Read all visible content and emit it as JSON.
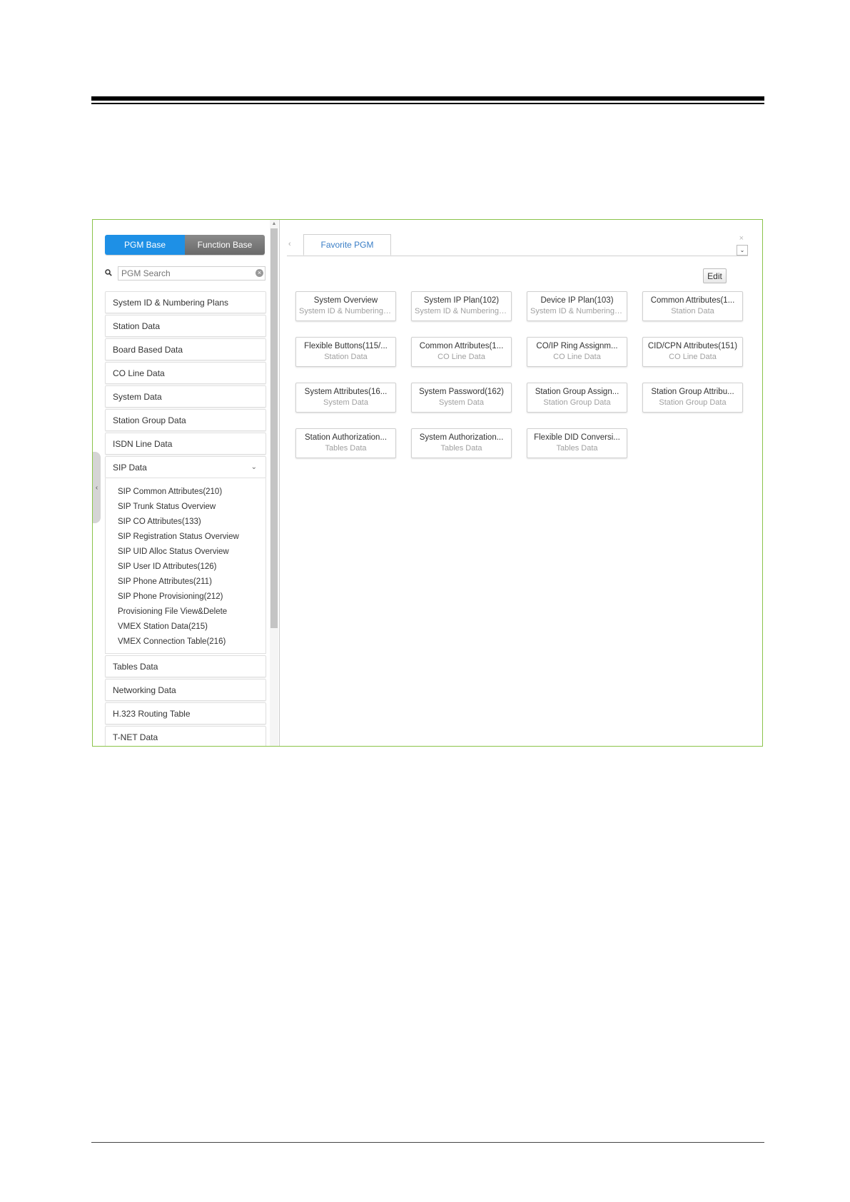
{
  "left_panel": {
    "tabs": [
      {
        "label": "PGM Base",
        "active": true
      },
      {
        "label": "Function Base",
        "active": false
      }
    ],
    "search": {
      "placeholder": "PGM Search"
    },
    "menu_before": [
      "System ID & Numbering Plans",
      "Station Data",
      "Board Based Data",
      "CO Line Data",
      "System Data",
      "Station Group Data",
      "ISDN Line Data"
    ],
    "open_menu": {
      "label": "SIP Data",
      "items": [
        "SIP Common Attributes(210)",
        "SIP Trunk Status Overview",
        "SIP CO Attributes(133)",
        "SIP Registration Status Overview",
        "SIP UID Alloc Status Overview",
        "SIP User ID Attributes(126)",
        "SIP Phone Attributes(211)",
        "SIP Phone Provisioning(212)",
        "Provisioning File View&Delete",
        "VMEX Station Data(215)",
        "VMEX Connection Table(216)"
      ]
    },
    "menu_after": [
      "Tables Data",
      "Networking Data",
      "H.323 Routing Table",
      "T-NET Data"
    ]
  },
  "right_panel": {
    "tab_label": "Favorite PGM",
    "edit_label": "Edit",
    "cards": [
      {
        "title": "System Overview",
        "sub": "System ID & Numbering Plans"
      },
      {
        "title": "System IP Plan(102)",
        "sub": "System ID & Numbering Plans"
      },
      {
        "title": "Device IP Plan(103)",
        "sub": "System ID & Numbering Plans"
      },
      {
        "title": "Common Attributes(1...",
        "sub": "Station Data"
      },
      {
        "title": "Flexible Buttons(115/...",
        "sub": "Station Data"
      },
      {
        "title": "Common Attributes(1...",
        "sub": "CO Line Data"
      },
      {
        "title": "CO/IP Ring Assignm...",
        "sub": "CO Line Data"
      },
      {
        "title": "CID/CPN Attributes(151)",
        "sub": "CO Line Data"
      },
      {
        "title": "System Attributes(16...",
        "sub": "System Data"
      },
      {
        "title": "System Password(162)",
        "sub": "System Data"
      },
      {
        "title": "Station Group Assign...",
        "sub": "Station Group Data"
      },
      {
        "title": "Station Group Attribu...",
        "sub": "Station Group Data"
      },
      {
        "title": "Station Authorization...",
        "sub": "Tables Data"
      },
      {
        "title": "System Authorization...",
        "sub": "Tables Data"
      },
      {
        "title": "Flexible DID Conversi...",
        "sub": "Tables Data"
      }
    ]
  },
  "colors": {
    "frame_border": "#8bc34a",
    "active_tab": "#1e90e6",
    "tab_text": "#3a7ec6"
  }
}
